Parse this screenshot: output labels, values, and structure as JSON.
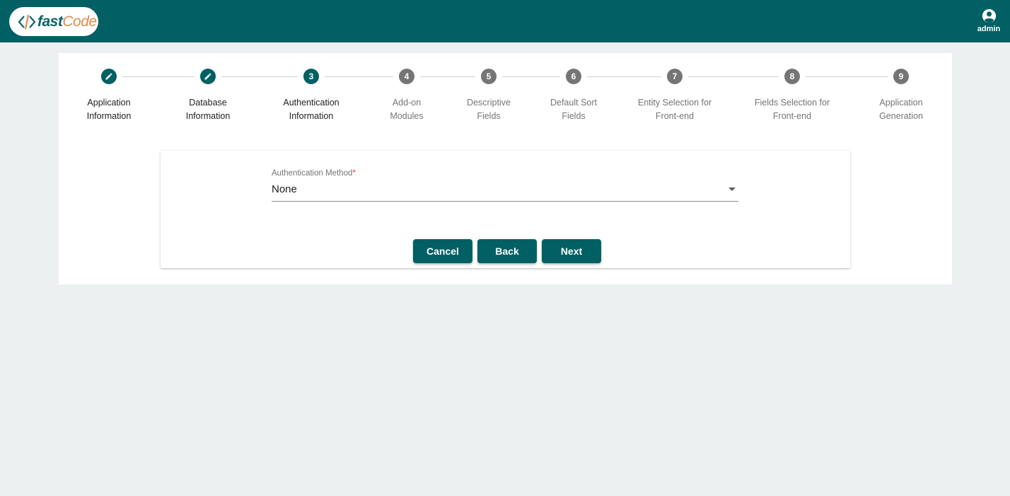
{
  "header": {
    "logo": {
      "fast": "fast",
      "code": "Code"
    },
    "user_label": "admin",
    "user_icon": "account-circle-icon"
  },
  "stepper": {
    "steps": [
      {
        "marker": "",
        "label": "Application\nInformation",
        "state": "done"
      },
      {
        "marker": "",
        "label": "Database\nInformation",
        "state": "done"
      },
      {
        "marker": "3",
        "label": "Authentication\nInformation",
        "state": "active"
      },
      {
        "marker": "4",
        "label": "Add-on\nModules",
        "state": "pending"
      },
      {
        "marker": "5",
        "label": "Descriptive\nFields",
        "state": "pending"
      },
      {
        "marker": "6",
        "label": "Default Sort\nFields",
        "state": "pending"
      },
      {
        "marker": "7",
        "label": "Entity Selection for\nFront-end",
        "state": "pending"
      },
      {
        "marker": "8",
        "label": "Fields Selection for\nFront-end",
        "state": "pending"
      },
      {
        "marker": "9",
        "label": "Application\nGeneration",
        "state": "pending"
      }
    ]
  },
  "form": {
    "auth_method": {
      "label": "Authentication Method",
      "required_mark": "*",
      "value": "None"
    }
  },
  "actions": {
    "cancel": "Cancel",
    "back": "Back",
    "next": "Next"
  },
  "colors": {
    "primary": "#006064",
    "background": "#edf0f1",
    "pending_step": "#757575",
    "logo_orange": "#e48a49"
  }
}
